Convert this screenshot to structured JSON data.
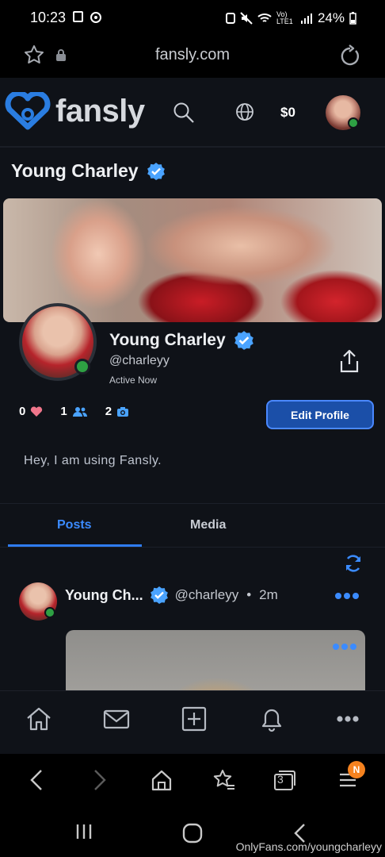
{
  "status_bar": {
    "time": "10:23",
    "battery": "24%",
    "network": "Vo) LTE1"
  },
  "browser": {
    "url": "fansly.com"
  },
  "header": {
    "brand": "fansly",
    "balance": "$0"
  },
  "profile": {
    "title": "Young Charley",
    "name": "Young Charley",
    "handle": "@charleyy",
    "status": "Active Now",
    "stats": {
      "likes": "0",
      "followers": "1",
      "media": "2"
    },
    "edit_label": "Edit Profile",
    "bio": "Hey, I am using Fansly."
  },
  "tabs": [
    {
      "label": "Posts"
    },
    {
      "label": "Media"
    }
  ],
  "post": {
    "name": "Young Ch...",
    "handle": "@charleyy",
    "separator": "•",
    "time": "2m"
  },
  "browser_bar": {
    "tab_count": "3",
    "menu_badge": "N"
  },
  "watermark": "OnlyFans.com/youngcharleyy",
  "colors": {
    "accent": "#2f7cf0",
    "verified": "#4aa3ff",
    "online": "#2ea043",
    "background": "#0f1218",
    "badge": "#f5821f"
  }
}
